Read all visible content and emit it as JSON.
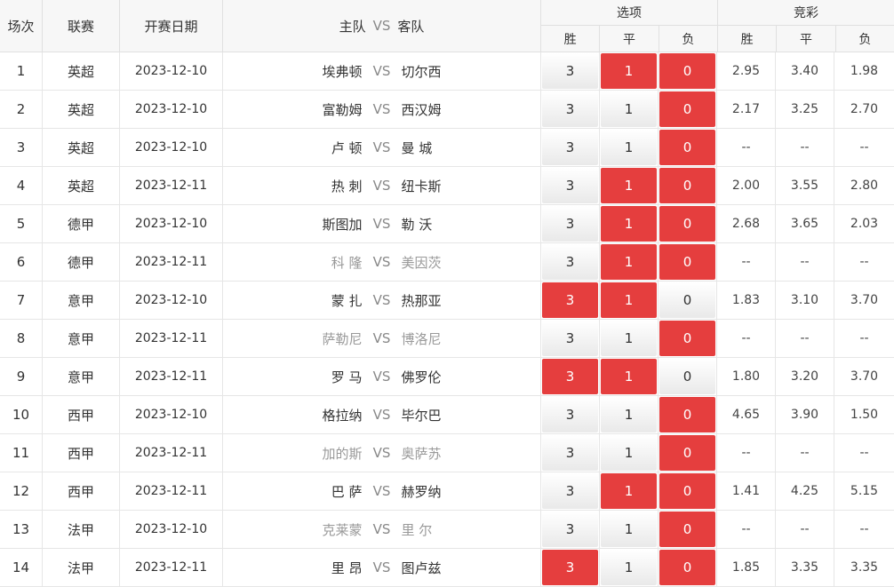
{
  "header": {
    "no": "场次",
    "league": "联赛",
    "date": "开赛日期",
    "match": {
      "home": "主队",
      "vs": "VS",
      "away": "客队"
    },
    "options": {
      "title": "选项",
      "win": "胜",
      "draw": "平",
      "lose": "负"
    },
    "odds": {
      "title": "竞彩",
      "win": "胜",
      "draw": "平",
      "lose": "负"
    }
  },
  "colors": {
    "selected": "#e53e3e",
    "muted_text": "#999999",
    "border": "#e6e6e6"
  },
  "rows": [
    {
      "no": "1",
      "league": "英超",
      "date": "2023-12-10",
      "home": "埃弗顿",
      "vs": "VS",
      "away": "切尔西",
      "muted": false,
      "opts": [
        "3",
        "1",
        "0"
      ],
      "sel": [
        false,
        true,
        true
      ],
      "odds": [
        "2.95",
        "3.40",
        "1.98"
      ]
    },
    {
      "no": "2",
      "league": "英超",
      "date": "2023-12-10",
      "home": "富勒姆",
      "vs": "VS",
      "away": "西汉姆",
      "muted": false,
      "opts": [
        "3",
        "1",
        "0"
      ],
      "sel": [
        false,
        false,
        true
      ],
      "odds": [
        "2.17",
        "3.25",
        "2.70"
      ]
    },
    {
      "no": "3",
      "league": "英超",
      "date": "2023-12-10",
      "home": "卢 顿",
      "vs": "VS",
      "away": "曼 城",
      "muted": false,
      "opts": [
        "3",
        "1",
        "0"
      ],
      "sel": [
        false,
        false,
        true
      ],
      "odds": [
        "--",
        "--",
        "--"
      ]
    },
    {
      "no": "4",
      "league": "英超",
      "date": "2023-12-11",
      "home": "热 刺",
      "vs": "VS",
      "away": "纽卡斯",
      "muted": false,
      "opts": [
        "3",
        "1",
        "0"
      ],
      "sel": [
        false,
        true,
        true
      ],
      "odds": [
        "2.00",
        "3.55",
        "2.80"
      ]
    },
    {
      "no": "5",
      "league": "德甲",
      "date": "2023-12-10",
      "home": "斯图加",
      "vs": "VS",
      "away": "勒 沃",
      "muted": false,
      "opts": [
        "3",
        "1",
        "0"
      ],
      "sel": [
        false,
        true,
        true
      ],
      "odds": [
        "2.68",
        "3.65",
        "2.03"
      ]
    },
    {
      "no": "6",
      "league": "德甲",
      "date": "2023-12-11",
      "home": "科 隆",
      "vs": "VS",
      "away": "美因茨",
      "muted": true,
      "opts": [
        "3",
        "1",
        "0"
      ],
      "sel": [
        false,
        true,
        true
      ],
      "odds": [
        "--",
        "--",
        "--"
      ]
    },
    {
      "no": "7",
      "league": "意甲",
      "date": "2023-12-10",
      "home": "蒙 扎",
      "vs": "VS",
      "away": "热那亚",
      "muted": false,
      "opts": [
        "3",
        "1",
        "0"
      ],
      "sel": [
        true,
        true,
        false
      ],
      "odds": [
        "1.83",
        "3.10",
        "3.70"
      ]
    },
    {
      "no": "8",
      "league": "意甲",
      "date": "2023-12-11",
      "home": "萨勒尼",
      "vs": "VS",
      "away": "博洛尼",
      "muted": true,
      "opts": [
        "3",
        "1",
        "0"
      ],
      "sel": [
        false,
        false,
        true
      ],
      "odds": [
        "--",
        "--",
        "--"
      ]
    },
    {
      "no": "9",
      "league": "意甲",
      "date": "2023-12-11",
      "home": "罗 马",
      "vs": "VS",
      "away": "佛罗伦",
      "muted": false,
      "opts": [
        "3",
        "1",
        "0"
      ],
      "sel": [
        true,
        true,
        false
      ],
      "odds": [
        "1.80",
        "3.20",
        "3.70"
      ]
    },
    {
      "no": "10",
      "league": "西甲",
      "date": "2023-12-10",
      "home": "格拉纳",
      "vs": "VS",
      "away": "毕尔巴",
      "muted": false,
      "opts": [
        "3",
        "1",
        "0"
      ],
      "sel": [
        false,
        false,
        true
      ],
      "odds": [
        "4.65",
        "3.90",
        "1.50"
      ]
    },
    {
      "no": "11",
      "league": "西甲",
      "date": "2023-12-11",
      "home": "加的斯",
      "vs": "VS",
      "away": "奥萨苏",
      "muted": true,
      "opts": [
        "3",
        "1",
        "0"
      ],
      "sel": [
        false,
        false,
        true
      ],
      "odds": [
        "--",
        "--",
        "--"
      ]
    },
    {
      "no": "12",
      "league": "西甲",
      "date": "2023-12-11",
      "home": "巴 萨",
      "vs": "VS",
      "away": "赫罗纳",
      "muted": false,
      "opts": [
        "3",
        "1",
        "0"
      ],
      "sel": [
        false,
        true,
        true
      ],
      "odds": [
        "1.41",
        "4.25",
        "5.15"
      ]
    },
    {
      "no": "13",
      "league": "法甲",
      "date": "2023-12-10",
      "home": "克莱蒙",
      "vs": "VS",
      "away": "里 尔",
      "muted": true,
      "opts": [
        "3",
        "1",
        "0"
      ],
      "sel": [
        false,
        false,
        true
      ],
      "odds": [
        "--",
        "--",
        "--"
      ]
    },
    {
      "no": "14",
      "league": "法甲",
      "date": "2023-12-11",
      "home": "里 昂",
      "vs": "VS",
      "away": "图卢兹",
      "muted": false,
      "opts": [
        "3",
        "1",
        "0"
      ],
      "sel": [
        true,
        false,
        true
      ],
      "odds": [
        "1.85",
        "3.35",
        "3.35"
      ]
    }
  ]
}
